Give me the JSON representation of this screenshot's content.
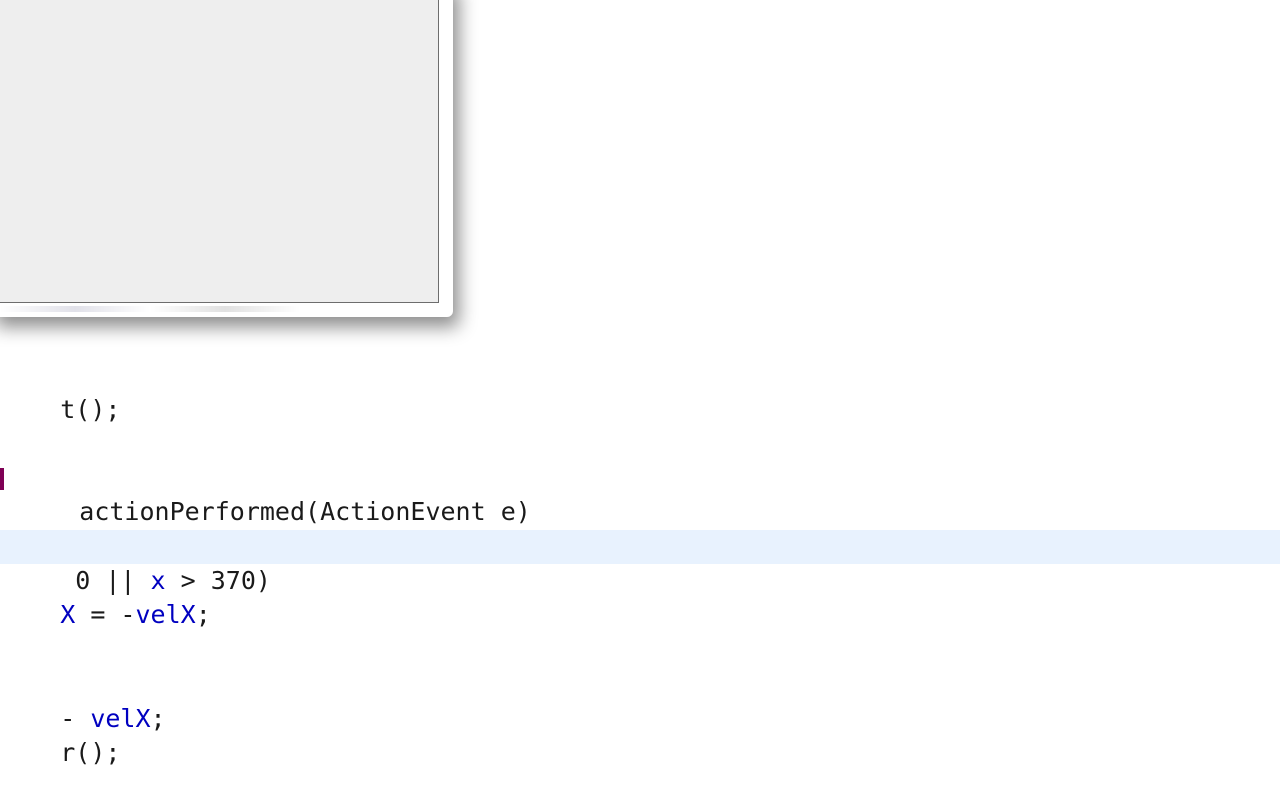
{
  "window": {
    "title": ""
  },
  "code": {
    "lines": [
      {
        "segments": [
          {
            "text": "t();",
            "kind": "plain"
          }
        ]
      },
      {
        "segments": [
          {
            "text": " actionPerformed(ActionEvent e)",
            "kind": "plain"
          }
        ]
      },
      {
        "segments": [
          {
            "text": " 0 || ",
            "kind": "plain"
          },
          {
            "text": "x",
            "kind": "field"
          },
          {
            "text": " > 370)",
            "kind": "plain"
          }
        ]
      },
      {
        "segments": [
          {
            "text": "X",
            "kind": "field"
          },
          {
            "text": " = -",
            "kind": "plain"
          },
          {
            "text": "velX",
            "kind": "field"
          },
          {
            "text": ";",
            "kind": "plain"
          }
        ]
      },
      {
        "segments": [
          {
            "text": "- ",
            "kind": "plain"
          },
          {
            "text": "velX",
            "kind": "field"
          },
          {
            "text": ";",
            "kind": "plain"
          }
        ]
      },
      {
        "segments": [
          {
            "text": "r();",
            "kind": "plain"
          }
        ]
      }
    ]
  },
  "colors": {
    "keyword": "#7f0055",
    "field": "#0000c0",
    "current_line": "#e8f2fe"
  }
}
